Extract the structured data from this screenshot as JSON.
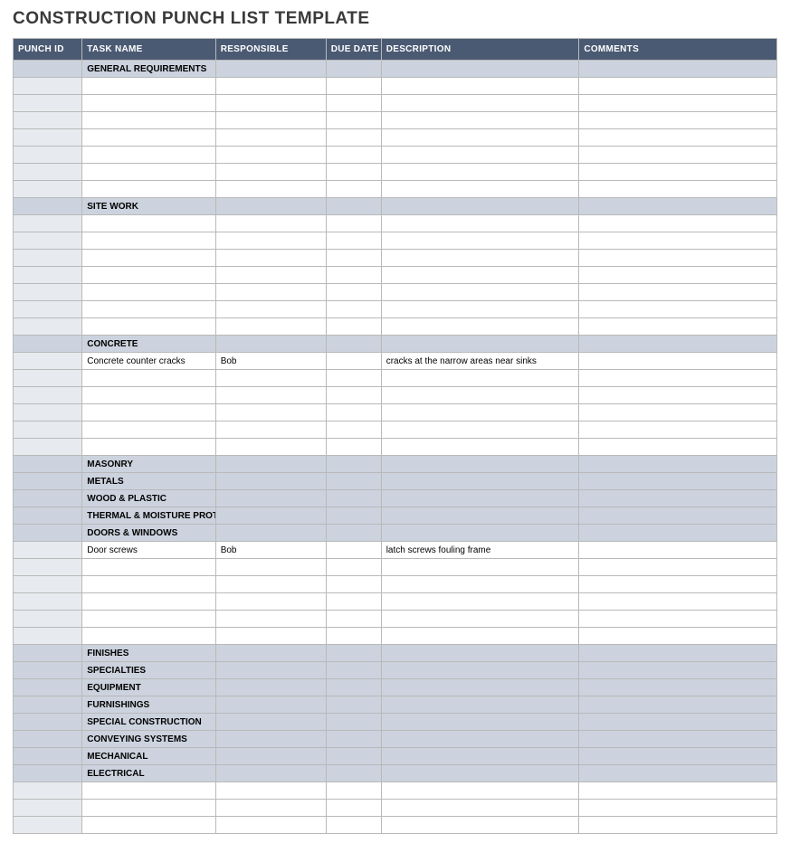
{
  "title": "CONSTRUCTION PUNCH LIST TEMPLATE",
  "columns": [
    "PUNCH ID",
    "TASK NAME",
    "RESPONSIBLE",
    "DUE DATE",
    "DESCRIPTION",
    "COMMENTS"
  ],
  "rows": [
    {
      "type": "section",
      "task_name": "GENERAL REQUIREMENTS"
    },
    {
      "type": "data"
    },
    {
      "type": "data"
    },
    {
      "type": "data"
    },
    {
      "type": "data"
    },
    {
      "type": "data"
    },
    {
      "type": "data"
    },
    {
      "type": "data"
    },
    {
      "type": "section",
      "task_name": "SITE WORK"
    },
    {
      "type": "data"
    },
    {
      "type": "data"
    },
    {
      "type": "data"
    },
    {
      "type": "data"
    },
    {
      "type": "data"
    },
    {
      "type": "data"
    },
    {
      "type": "data"
    },
    {
      "type": "section",
      "task_name": "CONCRETE"
    },
    {
      "type": "data",
      "task_name": "Concrete counter cracks",
      "responsible": "Bob",
      "description": "cracks at the narrow areas near sinks"
    },
    {
      "type": "data"
    },
    {
      "type": "data"
    },
    {
      "type": "data"
    },
    {
      "type": "data"
    },
    {
      "type": "data"
    },
    {
      "type": "section",
      "task_name": "MASONRY"
    },
    {
      "type": "section",
      "task_name": "METALS"
    },
    {
      "type": "section",
      "task_name": "WOOD & PLASTIC"
    },
    {
      "type": "section",
      "task_name": "THERMAL & MOISTURE PROTECTION"
    },
    {
      "type": "section",
      "task_name": "DOORS & WINDOWS"
    },
    {
      "type": "data",
      "task_name": "Door screws",
      "responsible": "Bob",
      "description": "latch screws fouling frame"
    },
    {
      "type": "data"
    },
    {
      "type": "data"
    },
    {
      "type": "data"
    },
    {
      "type": "data"
    },
    {
      "type": "data"
    },
    {
      "type": "section",
      "task_name": "FINISHES"
    },
    {
      "type": "section",
      "task_name": "SPECIALTIES"
    },
    {
      "type": "section",
      "task_name": "EQUIPMENT"
    },
    {
      "type": "section",
      "task_name": "FURNISHINGS"
    },
    {
      "type": "section",
      "task_name": "SPECIAL CONSTRUCTION"
    },
    {
      "type": "section",
      "task_name": "CONVEYING SYSTEMS"
    },
    {
      "type": "section",
      "task_name": "MECHANICAL"
    },
    {
      "type": "section",
      "task_name": "ELECTRICAL"
    },
    {
      "type": "data"
    },
    {
      "type": "data"
    },
    {
      "type": "data"
    }
  ]
}
